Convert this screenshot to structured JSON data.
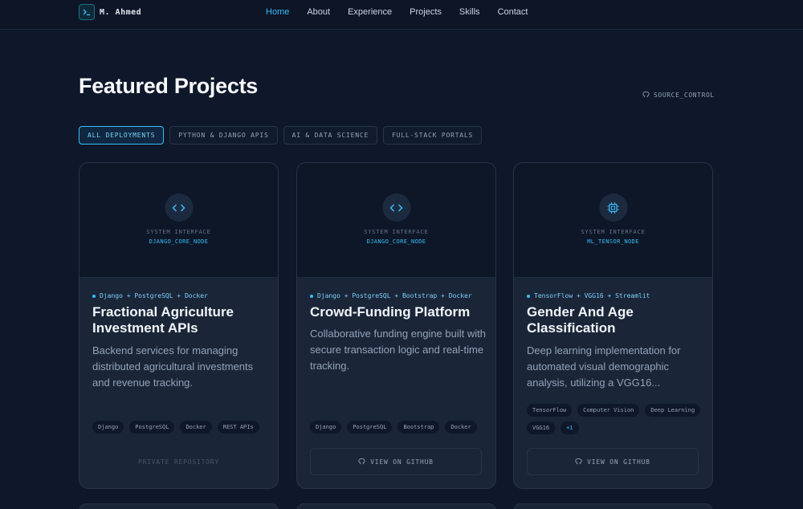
{
  "brand": {
    "name": "M. Ahmed",
    "logo_icon": "terminal-icon"
  },
  "nav": [
    {
      "label": "Home",
      "active": true
    },
    {
      "label": "About"
    },
    {
      "label": "Experience"
    },
    {
      "label": "Projects"
    },
    {
      "label": "Skills"
    },
    {
      "label": "Contact"
    }
  ],
  "section": {
    "title": "Featured Projects",
    "source_label": "SOURCE_CONTROL"
  },
  "filters": [
    {
      "label": "ALL DEPLOYMENTS",
      "active": true
    },
    {
      "label": "PYTHON & DJANGO APIS"
    },
    {
      "label": "AI & DATA SCIENCE"
    },
    {
      "label": "FULL-STACK PORTALS"
    }
  ],
  "projects": [
    {
      "icon": "code-icon",
      "system_label": "SYSTEM INTERFACE",
      "node": "DJANGO_CORE_NODE",
      "stack": "Django + PostgreSQL + Docker",
      "title": "Fractional Agriculture Investment APIs",
      "description": "Backend services for managing distributed agricultural investments and revenue tracking.",
      "tags": [
        "Django",
        "PostgreSQL",
        "Docker",
        "REST APIs"
      ],
      "action": "PRIVATE REPOSITORY"
    },
    {
      "icon": "code-icon",
      "system_label": "SYSTEM INTERFACE",
      "node": "DJANGO_CORE_NODE",
      "stack": "Django + PostgreSQL + Bootstrap + Docker",
      "title": "Crowd-Funding Platform",
      "description": "Collaborative funding engine built with secure transaction logic and real-time tracking.",
      "tags": [
        "Django",
        "PostgreSQL",
        "Bootstrap",
        "Docker"
      ],
      "action": "VIEW ON GITHUB"
    },
    {
      "icon": "cpu-icon",
      "system_label": "SYSTEM INTERFACE",
      "node": "ML_TENSOR_NODE",
      "stack": "TensorFlow + VGG16 + Streamlit",
      "title": "Gender And Age Classification",
      "description": "Deep learning implementation for automated visual demographic analysis, utilizing a VGG16...",
      "tags": [
        "TensorFlow",
        "Computer Vision",
        "Deep Learning",
        "VGG16"
      ],
      "more": "+1",
      "action": "VIEW ON GITHUB"
    }
  ]
}
